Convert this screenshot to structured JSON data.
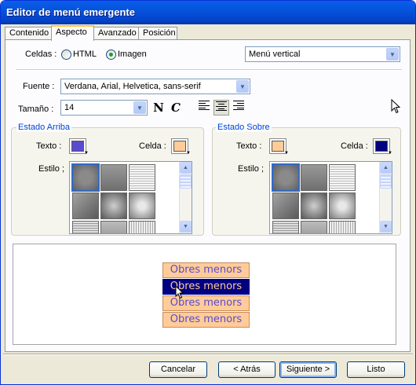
{
  "window": {
    "title": "Editor de menú emergente"
  },
  "tabs": [
    {
      "label": "Contenido",
      "active": false
    },
    {
      "label": "Aspecto",
      "active": true
    },
    {
      "label": "Avanzado",
      "active": false
    },
    {
      "label": "Posición",
      "active": false
    }
  ],
  "cells": {
    "label": "Celdas :",
    "options": [
      {
        "label": "HTML",
        "checked": false
      },
      {
        "label": "Imagen",
        "checked": true
      }
    ]
  },
  "menu_type": {
    "value": "Menú vertical"
  },
  "font": {
    "label": "Fuente :",
    "value": "Verdana, Arial, Helvetica, sans-serif"
  },
  "size": {
    "label": "Tamaño :",
    "value": "14",
    "bold_glyph": "N",
    "italic_glyph": "C"
  },
  "alignment": {
    "selected": "center"
  },
  "state_up": {
    "legend": "Estado Arriba",
    "text_label": "Texto :",
    "cell_label": "Celda :",
    "style_label": "Estilo ;",
    "text_color": "#5b4ad0",
    "cell_color": "#ffcc99"
  },
  "state_over": {
    "legend": "Estado Sobre",
    "text_label": "Texto :",
    "cell_label": "Celda :",
    "style_label": "Estilo ;",
    "text_color": "#ffcc99",
    "cell_color": "#000080"
  },
  "preview": {
    "items": [
      {
        "label": "Obres menors",
        "hover": false
      },
      {
        "label": "Obres menors",
        "hover": true
      },
      {
        "label": "Obres menors",
        "hover": false
      },
      {
        "label": "Obres menors",
        "hover": false
      }
    ]
  },
  "buttons": {
    "cancel": "Cancelar",
    "back": "< Atrás",
    "next": "Siguiente >",
    "finish": "Listo"
  }
}
